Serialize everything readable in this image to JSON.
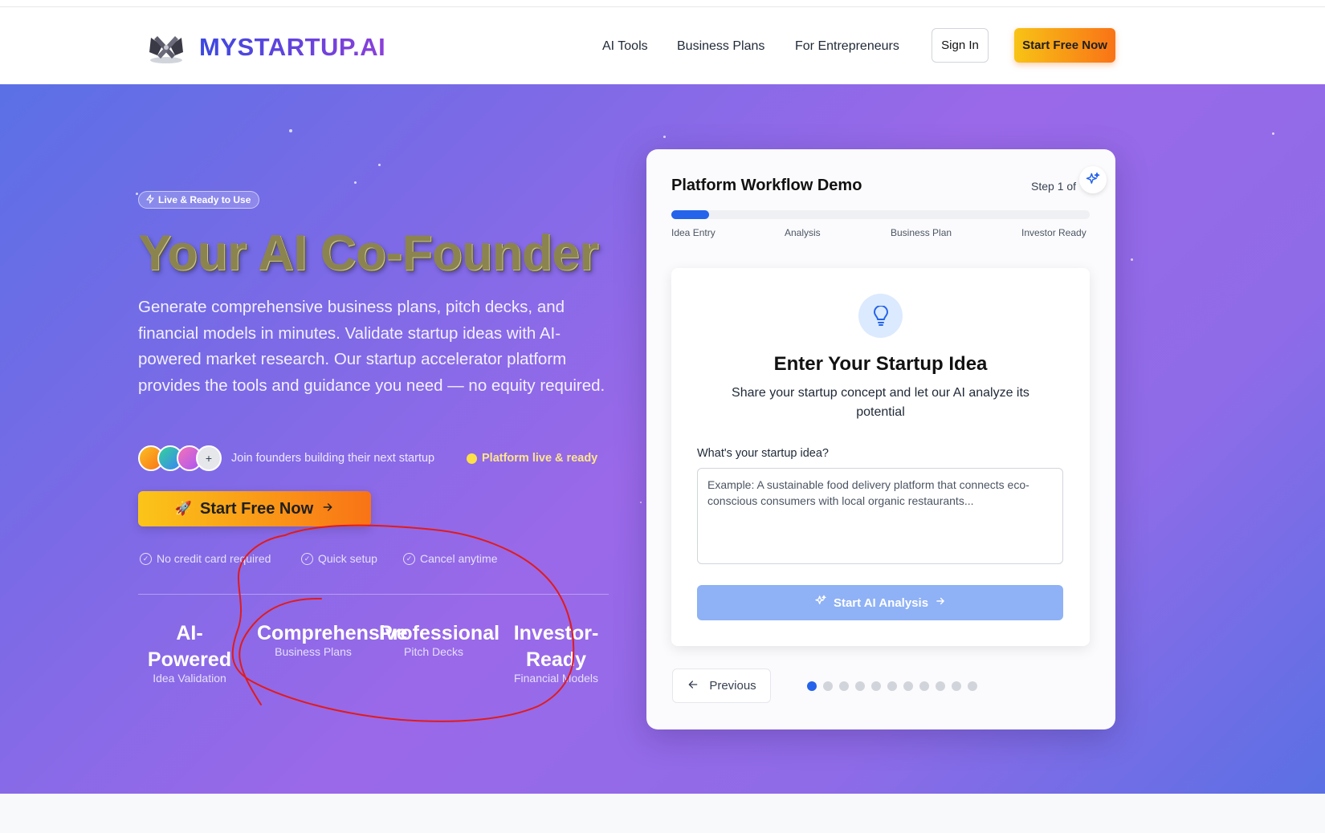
{
  "nav": {
    "brand": "MYSTARTUP.AI",
    "links": [
      "AI Tools",
      "Business Plans",
      "For Entrepreneurs"
    ],
    "sign_in": "Sign In",
    "start_free": "Start Free Now"
  },
  "hero": {
    "badge": "Live & Ready to Use",
    "title": "Your AI Co-Founder",
    "description": "Generate comprehensive business plans, pitch decks, and financial models in minutes. Validate startup ideas with AI-powered market research. Our startup accelerator platform provides the tools and guidance you need — no equity required.",
    "avatar_more": "+",
    "join_text": "Join founders building their next startup",
    "live_status": "Platform live & ready",
    "cta_emoji": "🚀",
    "cta_label": "Start Free Now",
    "checks": [
      "No credit card required",
      "Quick setup",
      "Cancel anytime"
    ],
    "stats": [
      {
        "big": "AI-Powered",
        "small": "Idea Validation"
      },
      {
        "big": "Comprehensive",
        "small": "Business Plans"
      },
      {
        "big": "Professional",
        "small": "Pitch Decks"
      },
      {
        "big": "Investor-Ready",
        "small": "Financial Models"
      }
    ]
  },
  "demo": {
    "title": "Platform Workflow Demo",
    "step": "Step 1 of",
    "progress": 0.09,
    "steps": [
      "Idea Entry",
      "Analysis",
      "Business Plan",
      "Investor Ready"
    ],
    "card_title": "Enter Your Startup Idea",
    "card_desc": "Share your startup concept and let our AI analyze its potential",
    "field_label": "What's your startup idea?",
    "field_placeholder": "Example: A sustainable food delivery platform that connects eco-conscious consumers with local organic restaurants...",
    "field_value": "",
    "analyze_label": "Start AI Analysis",
    "previous_label": "Previous",
    "dot_count": 11,
    "active_dot": 0
  },
  "colors": {
    "accent_blue": "#2563eb",
    "cta_gradient": [
      "#fbc519",
      "#f97316"
    ],
    "annotation_red": "#e01b1b"
  },
  "icons": {
    "logo": "logo-icon",
    "badge": "lightning-icon",
    "sparkle": "sparkle-icon",
    "bulb": "lightbulb-icon",
    "arrow_right": "arrow-right-icon",
    "arrow_left": "arrow-left-icon",
    "check": "check-circle-icon"
  }
}
